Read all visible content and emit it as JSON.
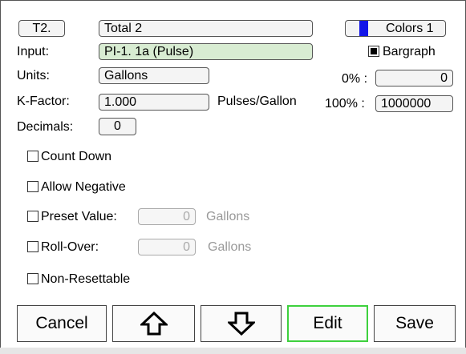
{
  "header": {
    "tag_label": "T2.",
    "name_value": "Total 2",
    "colors_label": "Colors 1",
    "colors_swatch": "#1316e8"
  },
  "input": {
    "label": "Input:",
    "value": "PI-1. 1a (Pulse)"
  },
  "bargraph": {
    "label": "Bargraph",
    "checked": true
  },
  "units": {
    "label": "Units:",
    "value": "Gallons"
  },
  "zero": {
    "label": "0% :",
    "value": "0"
  },
  "kfactor": {
    "label": "K-Factor:",
    "value": "1.000",
    "unit": "Pulses/Gallon"
  },
  "hundred": {
    "label": "100% :",
    "value": "1000000"
  },
  "decimals": {
    "label": "Decimals:",
    "value": "0"
  },
  "options": {
    "count_down": "Count Down",
    "allow_negative": "Allow Negative",
    "preset_value": {
      "label": "Preset Value:",
      "value": "0",
      "unit": "Gallons"
    },
    "roll_over": {
      "label": "Roll-Over:",
      "value": "0",
      "unit": "Gallons"
    },
    "non_resettable": "Non-Resettable"
  },
  "buttons": {
    "cancel": "Cancel",
    "up_icon": "arrow-up-icon",
    "down_icon": "arrow-down-icon",
    "edit": "Edit",
    "save": "Save"
  }
}
